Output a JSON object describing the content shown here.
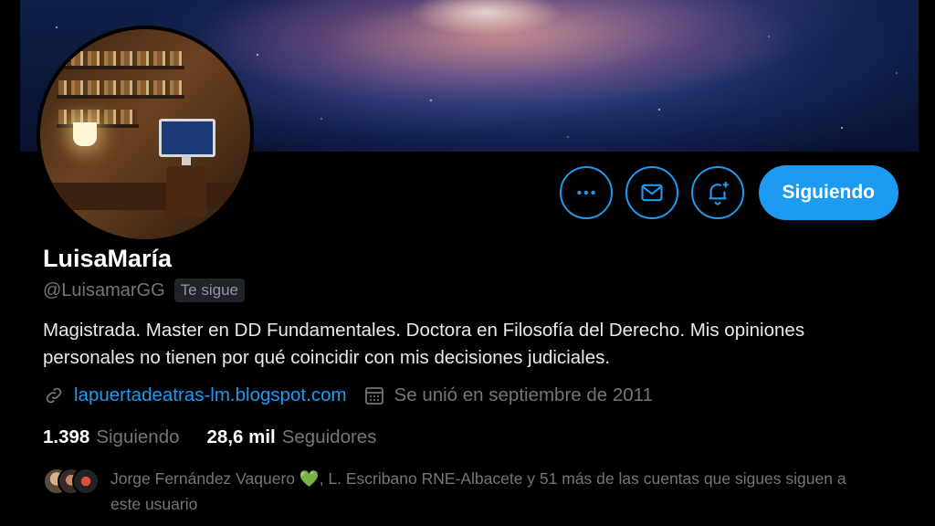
{
  "profile": {
    "display_name": "LuisaMaría",
    "handle": "@LuisamarGG",
    "follows_you_badge": "Te sigue",
    "bio": "Magistrada. Master en DD Fundamentales. Doctora en Filosofía del Derecho. Mis opiniones personales no tienen por qué coincidir con mis decisiones judiciales.",
    "website": "lapuertadeatras-lm.blogspot.com",
    "joined": "Se unió en septiembre de 2011"
  },
  "actions": {
    "more_icon": "more-icon",
    "message_icon": "mail-icon",
    "notify_icon": "bell-plus-icon",
    "follow_button_label": "Siguiendo"
  },
  "stats": {
    "following_count": "1.398",
    "following_label": "Siguiendo",
    "followers_count": "28,6 mil",
    "followers_label": "Seguidores"
  },
  "mutuals": {
    "line_part1": "Jorge Fernández Vaquero",
    "emoji": "💚",
    "line_part2": ", L. Escribano RNE-Albacete y 51 más de las cuentas que sigues siguen a este usuario"
  },
  "colors": {
    "accent": "#1d9bf0",
    "background": "#000000",
    "secondary_text": "#71767b"
  }
}
